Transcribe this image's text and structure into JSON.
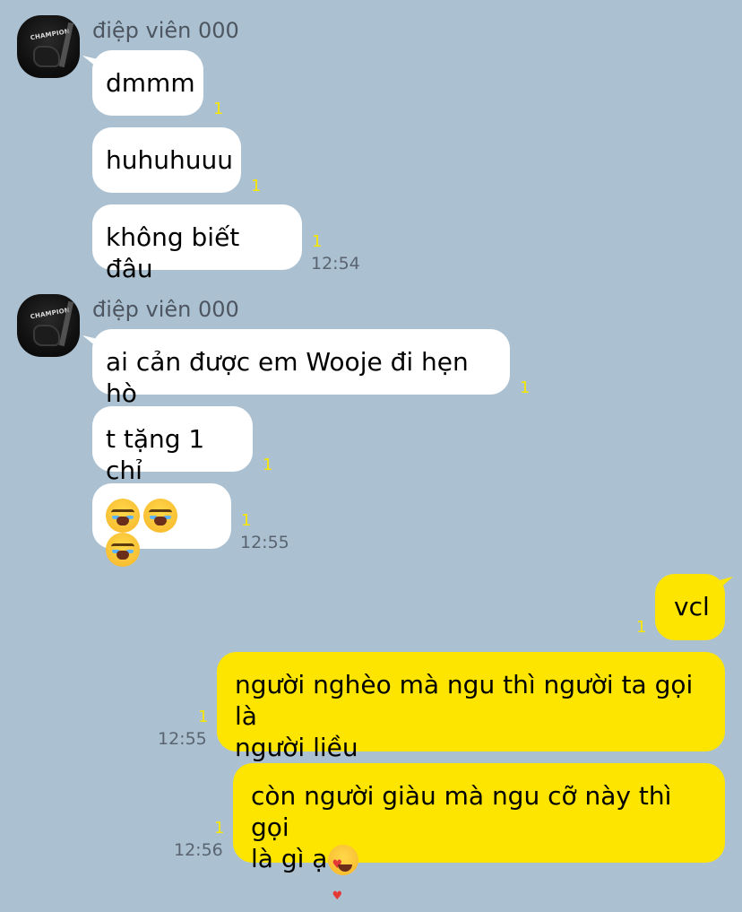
{
  "conversation": {
    "groups": [
      {
        "sender": "điệp viên 000",
        "messages": [
          {
            "text": "dmmm",
            "unread": "1"
          },
          {
            "text": "huhuhuuu",
            "unread": "1"
          },
          {
            "text": "không biết đâu",
            "unread": "1",
            "time": "12:54"
          }
        ]
      },
      {
        "sender": "điệp viên 000",
        "messages": [
          {
            "text": "ai cản được em Wooje đi hẹn hò",
            "unread": "1"
          },
          {
            "text": "t tặng 1 chỉ",
            "unread": "1"
          },
          {
            "text": "",
            "emoji": [
              "loudly-crying-face-emoji",
              "loudly-crying-face-emoji",
              "loudly-crying-face-emoji"
            ],
            "unread": "1",
            "time": "12:55"
          }
        ]
      }
    ],
    "outgoing": [
      {
        "text": "vcl",
        "unread": "1"
      },
      {
        "line1": "người nghèo mà ngu thì người ta gọi là",
        "line2": "người liều",
        "unread": "1",
        "time": "12:55"
      },
      {
        "line1": "còn người giàu mà ngu cỡ này thì gọi",
        "line2": "là gì ạ",
        "emoji": "smiling-face-with-heart-eyes-emoji",
        "unread": "1",
        "time": "12:56"
      }
    ]
  },
  "colors": {
    "background": "#abc1d1",
    "incoming_bubble": "#ffffff",
    "outgoing_bubble": "#fee500",
    "unread_count": "#f7e600"
  }
}
